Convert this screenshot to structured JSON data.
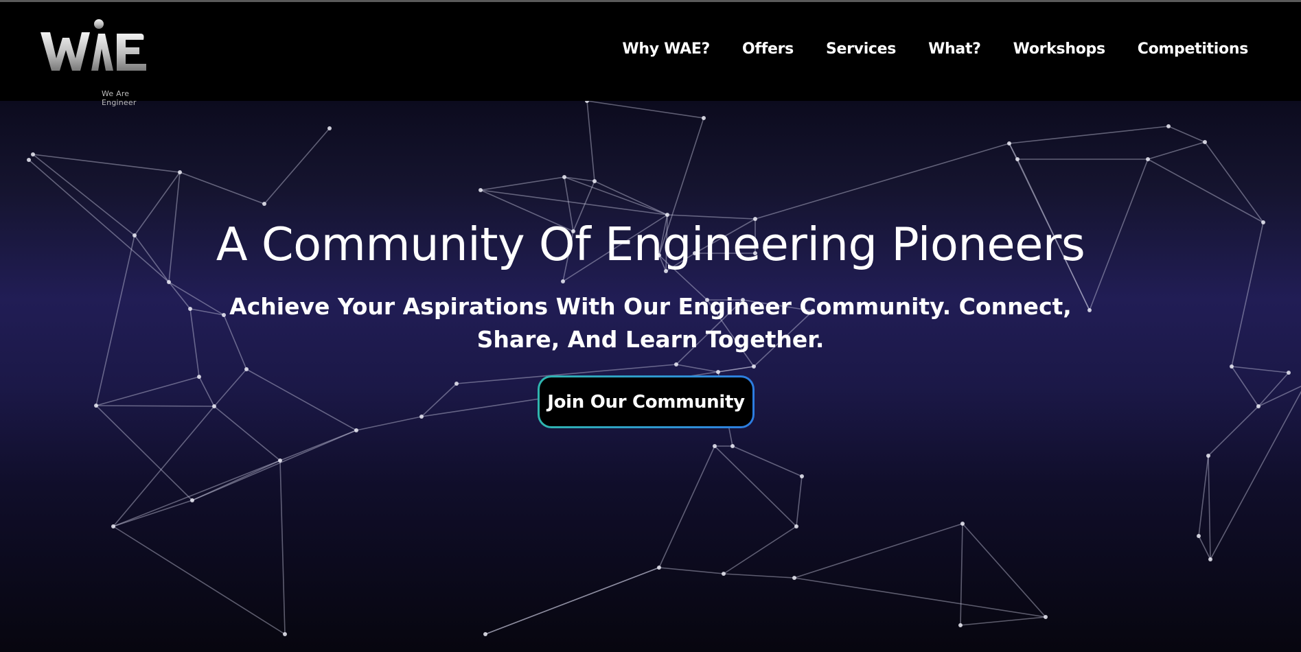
{
  "brand": {
    "logo_text": "WAE",
    "tagline": "We Are Engineer"
  },
  "nav": {
    "items": [
      {
        "label": "Why WAE?"
      },
      {
        "label": "Offers"
      },
      {
        "label": "Services"
      },
      {
        "label": "What?"
      },
      {
        "label": "Workshops"
      },
      {
        "label": "Competitions"
      }
    ]
  },
  "hero": {
    "title": "A Community Of Engineering Pioneers",
    "subtitle": "Achieve Your Aspirations With Our Engineer Community. Connect, Share, And Learn Together.",
    "cta_label": "Join Our Community"
  },
  "colors": {
    "nav_background": "#000000",
    "hero_gradient_mid": "#211d55",
    "cta_border_start": "#2fb5ae",
    "cta_border_end": "#2c7be0"
  }
}
